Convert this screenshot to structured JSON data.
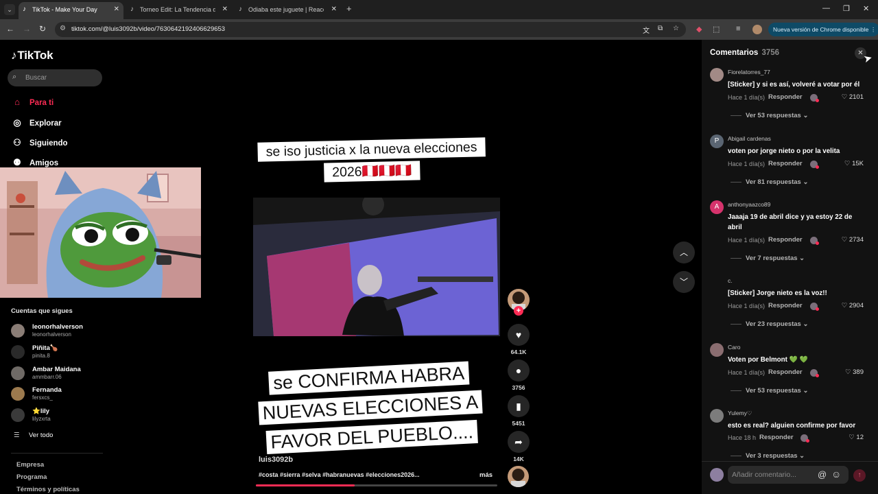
{
  "browser": {
    "tabs": [
      {
        "title": "TikTok - Make Your Day",
        "active": true
      },
      {
        "title": "Torneo Edit: La Tendencia del M",
        "active": false
      },
      {
        "title": "Odiaba este juguete | Reaccion",
        "active": false
      }
    ],
    "new_tab": "+",
    "url": "tiktok.com/@luis3092b/video/7630642192406629653",
    "update_label": "Nueva versión de Chrome disponible"
  },
  "sidebar": {
    "logo": "TikTok",
    "search_placeholder": "Buscar",
    "nav": [
      {
        "label": "Para ti",
        "icon": "home-icon",
        "active": true
      },
      {
        "label": "Explorar",
        "icon": "compass-icon",
        "active": false
      },
      {
        "label": "Siguiendo",
        "icon": "following-icon",
        "active": false
      },
      {
        "label": "Amigos",
        "icon": "friends-icon",
        "active": false
      }
    ],
    "following_title": "Cuentas que sigues",
    "accounts": [
      {
        "name": "leonorhalverson",
        "handle": "leonorhalverson"
      },
      {
        "name": "Piñita🍗",
        "handle": "pinita.8"
      },
      {
        "name": "Ambar Maidana",
        "handle": "ammbarr.06"
      },
      {
        "name": "Fernanda",
        "handle": "fersxcs_"
      },
      {
        "name": "⭐lily",
        "handle": "lilyzxrta"
      }
    ],
    "see_all": "Ver todo",
    "footer_links": [
      "Empresa",
      "Programa",
      "Términos y políticas"
    ]
  },
  "video": {
    "caption_top": "se iso justicia x la nueva elecciones 2026🇵🇪🇵🇪🇵🇪",
    "caption_bottom": "se CONFIRMA HABRA NUEVAS ELECCIONES A FAVOR DEL PUEBLO....",
    "author": "luis3092b",
    "hashtags": "#costa #sierra #selva #habranuevas #elecciones2026...",
    "more": "más",
    "progress": 0.41
  },
  "actions": {
    "likes": "64.1K",
    "comments": "3756",
    "saves": "5451",
    "shares": "14K"
  },
  "comments": {
    "title": "Comentarios",
    "count": "3756",
    "reply_label": "Responder",
    "items": [
      {
        "user": "Fiorelatorres_77",
        "text": "[Sticker] y si es así, volveré a votar por él",
        "time": "Hace 1 día(s)",
        "likes": "2101",
        "replies": "Ver 53 respuestas",
        "initial": ""
      },
      {
        "user": "Abigail cardenas",
        "text": "voten por jorge nieto o por la velita",
        "time": "Hace 1 día(s)",
        "likes": "15K",
        "replies": "Ver 81 respuestas",
        "initial": "P"
      },
      {
        "user": "anthonyaazco89",
        "text": "Jaaaja 19 de abril dice y ya estoy 22 de abril",
        "time": "Hace 1 día(s)",
        "likes": "2734",
        "replies": "Ver 7 respuestas",
        "initial": "A"
      },
      {
        "user": "c.",
        "text": "[Sticker] Jorge nieto es la voz!!",
        "time": "Hace 1 día(s)",
        "likes": "2904",
        "replies": "Ver 23 respuestas",
        "initial": ""
      },
      {
        "user": "Caro",
        "text": "Voten por Belmont 💚 💚",
        "time": "Hace 1 día(s)",
        "likes": "389",
        "replies": "Ver 53 respuestas",
        "initial": ""
      },
      {
        "user": "Yulemy♡",
        "text": "esto es real? alguien confirme por favor",
        "time": "Hace 18 h",
        "likes": "12",
        "replies": "Ver 3 respuestas",
        "initial": ""
      }
    ],
    "input_placeholder": "Añadir comentario..."
  },
  "colors": {
    "brand": "#fe2c55",
    "update_pill": "#0e4a66"
  }
}
